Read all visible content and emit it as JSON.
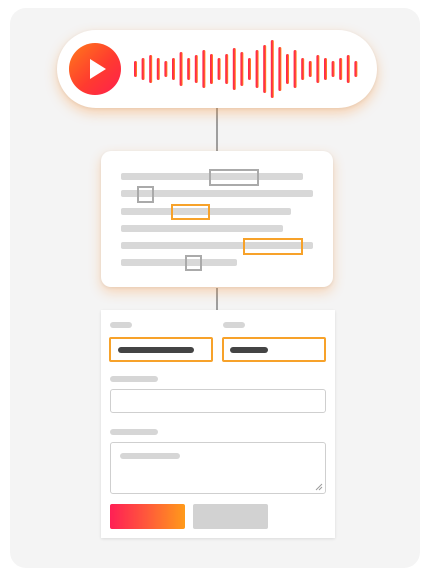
{
  "colors": {
    "accent_orange": "#f7a22a",
    "gradient_start": "#ff1f55",
    "gradient_end": "#ff9a1a",
    "placeholder_gray": "#d6d6d6",
    "value_dark": "#444444"
  },
  "icons": {
    "play": "play-icon",
    "waveform": "audio-waveform"
  },
  "form": {
    "field_count": 4,
    "highlighted_fields": 2
  }
}
